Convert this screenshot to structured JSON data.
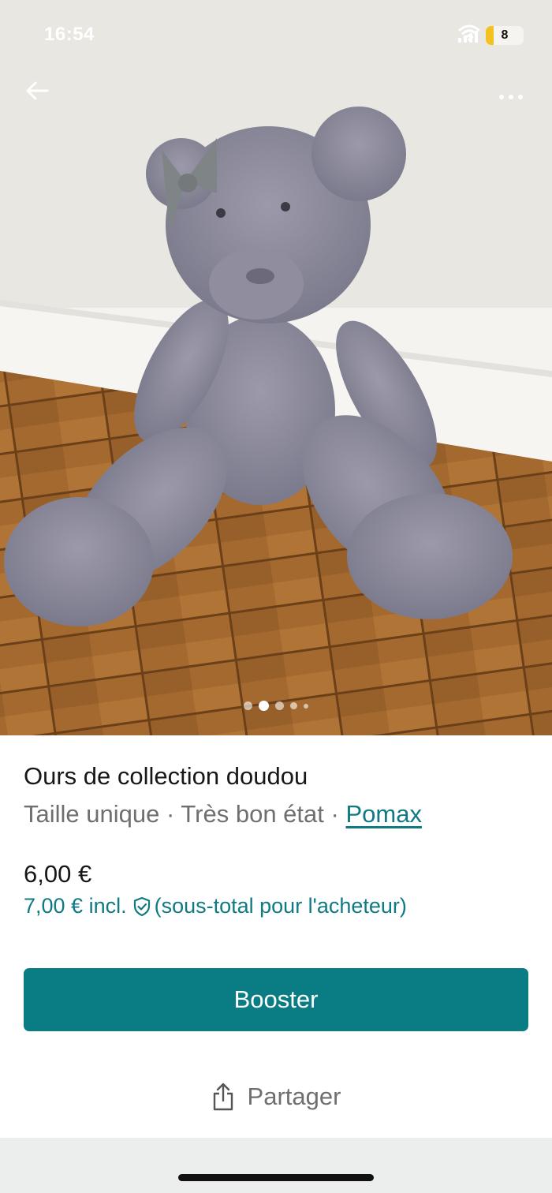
{
  "status_bar": {
    "time": "16:54",
    "battery": "8"
  },
  "photo": {
    "alt": "Ours de collection doudou",
    "carousel": {
      "count": 5,
      "active": 1
    }
  },
  "nav": {
    "back_icon": "arrow-left-icon",
    "more_icon": "more-horizontal-icon"
  },
  "item": {
    "title": "Ours de collection doudou",
    "size": "Taille unique",
    "separator": "·",
    "condition": "Très bon état",
    "brand": "Pomax",
    "price": "6,00 €",
    "price_incl_amount": "7,00 € incl.",
    "price_incl_note": "(sous-total pour l'acheteur)"
  },
  "actions": {
    "booster_label": "Booster",
    "share_label": "Partager"
  },
  "colors": {
    "accent": "#097d83",
    "link": "#0f7a83",
    "muted": "#6f6f6f"
  }
}
